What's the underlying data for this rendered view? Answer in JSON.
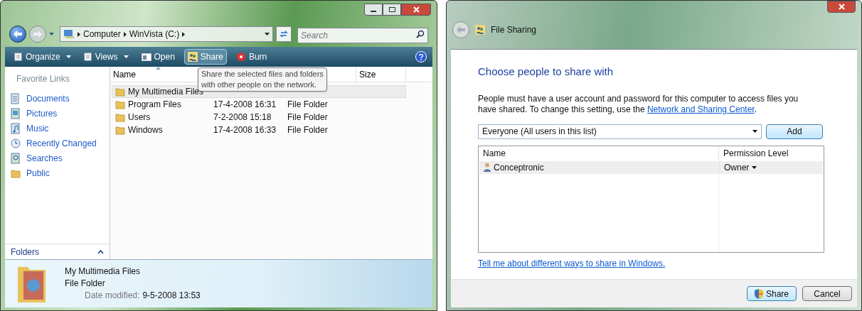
{
  "explorer": {
    "breadcrumb": [
      "Computer",
      "WinVista (C:)"
    ],
    "search_placeholder": "Search",
    "toolbar": [
      {
        "label": "Organize",
        "kind": "menu",
        "selected": false
      },
      {
        "label": "Views",
        "kind": "menu",
        "selected": false
      },
      {
        "label": "Open",
        "kind": "open",
        "selected": false
      },
      {
        "label": "Share",
        "kind": "share",
        "selected": true
      },
      {
        "label": "Burn",
        "kind": "burn",
        "selected": false
      }
    ],
    "favorites_title": "Favorite Links",
    "links": [
      {
        "label": "Documents",
        "kind": "documents"
      },
      {
        "label": "Pictures",
        "kind": "pictures"
      },
      {
        "label": "Music",
        "kind": "music"
      },
      {
        "label": "Recently Changed",
        "kind": "recent"
      },
      {
        "label": "Searches",
        "kind": "searches"
      },
      {
        "label": "Public",
        "kind": "folder"
      }
    ],
    "folders_label": "Folders",
    "columns": [
      {
        "label": "Name",
        "sorted": true
      },
      {
        "label": "Size",
        "sorted": false
      }
    ],
    "rows": [
      {
        "name": "My Multimedia Files",
        "date": "",
        "type": "",
        "selected": true
      },
      {
        "name": "Program Files",
        "date": "17-4-2008 16:31",
        "type": "File Folder",
        "selected": false
      },
      {
        "name": "Users",
        "date": "7-2-2008 15:18",
        "type": "File Folder",
        "selected": false
      },
      {
        "name": "Windows",
        "date": "17-4-2008 16:33",
        "type": "File Folder",
        "selected": false
      }
    ],
    "tooltip": [
      "Share the selected files and folders",
      "with other people on the network."
    ],
    "details": {
      "name": "My Multimedia Files",
      "type": "File Folder",
      "date_label": "Date modified:",
      "date_value": "9-5-2008 13:53"
    }
  },
  "sharing": {
    "title": "File Sharing",
    "heading": "Choose people to share with",
    "text_before": "People must have a user account and password for this computer to access files you have shared.  To change this setting, use the ",
    "link": "Network and Sharing Center",
    "text_after": ".",
    "picker": "Everyone (All users in this list)",
    "add": "Add",
    "columns": [
      "Name",
      "Permission Level"
    ],
    "rows": [
      {
        "name": "Conceptronic",
        "permission": "Owner",
        "selected": true
      }
    ],
    "help_link": "Tell me about different ways to share in Windows.",
    "buttons": [
      {
        "label": "Share",
        "kind": "shield",
        "default": true
      },
      {
        "label": "Cancel",
        "kind": "plain",
        "default": false
      }
    ]
  }
}
